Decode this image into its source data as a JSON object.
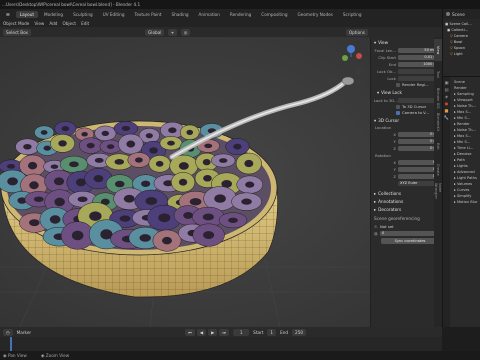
{
  "window": {
    "title": "...Users\\Desktop\\WIP\\cereal bowl\\Cereal bowl.blend] - Blender 4.1"
  },
  "workspaces": [
    "Layout",
    "Modeling",
    "Sculpting",
    "UV Editing",
    "Texture Paint",
    "Shading",
    "Animation",
    "Rendering",
    "Compositing",
    "Geometry Nodes",
    "Scripting"
  ],
  "active_workspace": "Layout",
  "scene_name": "Scene",
  "menu": [
    "View",
    "Add",
    "Object",
    "Edit"
  ],
  "viewport_header": {
    "mode": "Object Mode",
    "mode_trunc": "Select Box",
    "orientation": "Global",
    "options": "Options"
  },
  "npanel": {
    "view_title": "View",
    "focal_label": "Focal Len...",
    "focal_value": "50 mm",
    "clip_start_label": "Clip Start",
    "clip_start_value": "0.01 m",
    "end_label": "End",
    "end_value": "1000 m",
    "lock_object_label": "Lock Ob...",
    "lock_label": "Lock",
    "render_region": "Render Regi...",
    "view_lock_title": "View Lock",
    "lock_to_3d_label": "Lock to 3D...",
    "to_3d_cursor": "To 3D Cursor",
    "camera_to_view": "Camera to V...",
    "cursor_title": "3D Cursor",
    "location_label": "Location",
    "rotation_label": "Rotation",
    "x": "X",
    "y": "Y",
    "z": "Z",
    "x_val": "0 m",
    "y_val": "0 m",
    "z_val": "0 m",
    "rx_val": "0°",
    "ry_val": "0°",
    "rz_val": "0°",
    "rotation_mode": "XYZ Euler",
    "collections": "Collections",
    "annotations": "Annotations",
    "decorators": "Decorators",
    "scene_geo_title": "Scene georeferencing",
    "not_set": "Not set",
    "georef_value": "0",
    "sync_btn": "Sync coordinates"
  },
  "npanel_tabs": [
    "View",
    "Tool",
    "Blender GIS",
    "BlenderKit",
    "Edit",
    "Create",
    "Node Wrangler"
  ],
  "outliner": [
    "Scene Coll...",
    "Collecti...",
    "Camera",
    "Bowl",
    "Spoon",
    "Light"
  ],
  "properties": [
    "Scene",
    "Render",
    "Sampling",
    "Viewport",
    "Noise Th...",
    "Max S...",
    "Min S...",
    "Render",
    "Noise Th...",
    "Max S...",
    "Min S...",
    "Time Li...",
    "Denoise",
    "Path",
    "Lights",
    "Advanced",
    "Light Paths",
    "Volumes",
    "Curves",
    "Simplify",
    "Motion Blur"
  ],
  "timeline": {
    "label": "Marker",
    "frame": "1",
    "start_label": "Start",
    "start": "1",
    "end_label": "End",
    "end": "250"
  },
  "statusbar": [
    "Pan View",
    "Zoom View"
  ],
  "colors": {
    "accent": "#4772b3",
    "bowl": "#d8c27a",
    "wire": "#1f1f1f"
  },
  "rings": [
    {
      "color": "#5a8fa0"
    },
    {
      "color": "#8f7ba3"
    },
    {
      "color": "#a7a85a"
    },
    {
      "color": "#6e4f82"
    },
    {
      "color": "#a3727a"
    },
    {
      "color": "#58906f"
    },
    {
      "color": "#4c3f7a"
    }
  ]
}
